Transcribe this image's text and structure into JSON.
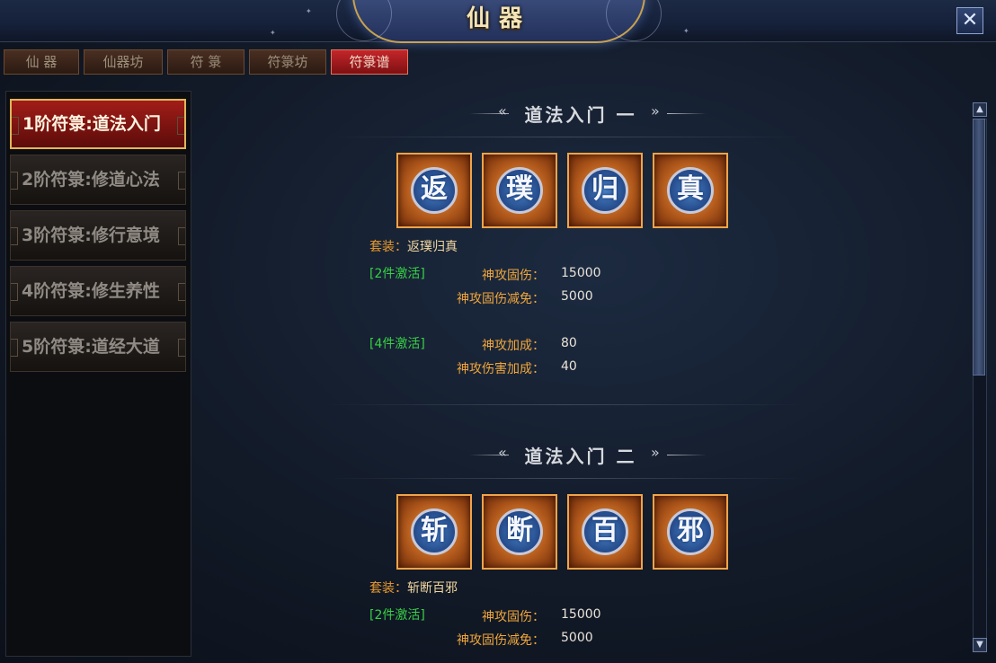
{
  "window": {
    "title": "仙器",
    "close_label": "✕"
  },
  "tabs": [
    {
      "label": "仙 器",
      "active": false
    },
    {
      "label": "仙器坊",
      "active": false
    },
    {
      "label": "符 箓",
      "active": false
    },
    {
      "label": "符箓坊",
      "active": false
    },
    {
      "label": "符箓谱",
      "active": true
    }
  ],
  "sidebar": {
    "items": [
      {
        "label": "1阶符箓:道法入门",
        "active": true
      },
      {
        "label": "2阶符箓:修道心法",
        "active": false
      },
      {
        "label": "3阶符箓:修行意境",
        "active": false
      },
      {
        "label": "4阶符箓:修生养性",
        "active": false
      },
      {
        "label": "5阶符箓:道经大道",
        "active": false
      }
    ]
  },
  "sections": [
    {
      "title": "道法入门 一",
      "icons": [
        "返",
        "璞",
        "归",
        "真"
      ],
      "set_prefix": "套装：",
      "set_name": "返璞归真",
      "bonuses": [
        {
          "activation": "[2件激活]",
          "attrs": [
            {
              "name": "神攻固伤：",
              "value": "15000"
            },
            {
              "name": "神攻固伤减免：",
              "value": "5000"
            }
          ]
        },
        {
          "activation": "[4件激活]",
          "attrs": [
            {
              "name": "神攻加成：",
              "value": "80"
            },
            {
              "name": "神攻伤害加成：",
              "value": "40"
            }
          ]
        }
      ]
    },
    {
      "title": "道法入门 二",
      "icons": [
        "斩",
        "断",
        "百",
        "邪"
      ],
      "set_prefix": "套装：",
      "set_name": "斩断百邪",
      "bonuses": [
        {
          "activation": "[2件激活]",
          "attrs": [
            {
              "name": "神攻固伤：",
              "value": "15000"
            },
            {
              "name": "神攻固伤减免：",
              "value": "5000"
            }
          ]
        }
      ]
    }
  ],
  "scroll": {
    "up_icon": "▲",
    "down_icon": "▼"
  }
}
